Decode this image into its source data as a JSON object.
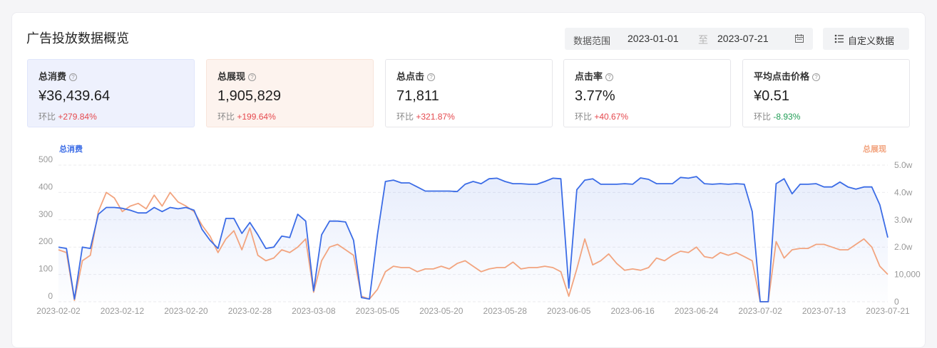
{
  "header": {
    "title": "广告投放数据概览",
    "range_label": "数据范围",
    "start_date": "2023-01-01",
    "range_sep": "至",
    "end_date": "2023-07-21",
    "custom_label": "自定义数据"
  },
  "metrics": [
    {
      "label": "总消费",
      "value": "¥36,439.64",
      "change_label": "环比",
      "change": "+279.84%",
      "trend": "up"
    },
    {
      "label": "总展现",
      "value": "1,905,829",
      "change_label": "环比",
      "change": "+199.64%",
      "trend": "up"
    },
    {
      "label": "总点击",
      "value": "71,811",
      "change_label": "环比",
      "change": "+321.87%",
      "trend": "up"
    },
    {
      "label": "点击率",
      "value": "3.77%",
      "change_label": "环比",
      "change": "+40.67%",
      "trend": "up"
    },
    {
      "label": "平均点击价格",
      "value": "¥0.51",
      "change_label": "环比",
      "change": "-8.93%",
      "trend": "down"
    }
  ],
  "colors": {
    "spend": "#3b6ce6",
    "impressions": "#f2a47f",
    "up": "#e5484d",
    "down": "#1f9d55"
  },
  "chart_data": {
    "type": "line",
    "left_axis_label": "总消费",
    "right_axis_label": "总展现",
    "y_left_ticks": [
      "500",
      "400",
      "300",
      "200",
      "100",
      "0"
    ],
    "y_right_ticks": [
      "5.0w",
      "4.0w",
      "3.0w",
      "2.0w",
      "10,000",
      "0"
    ],
    "ylim_left": [
      0,
      500
    ],
    "ylim_right": [
      0,
      50000
    ],
    "x_ticks": [
      "2023-02-02",
      "2023-02-12",
      "2023-02-20",
      "2023-02-28",
      "2023-03-08",
      "2023-05-05",
      "2023-05-20",
      "2023-05-28",
      "2023-06-05",
      "2023-06-16",
      "2023-06-24",
      "2023-07-02",
      "2023-07-13",
      "2023-07-21"
    ],
    "grid": "horizontal dashed",
    "series": [
      {
        "name": "总消费",
        "axis": "left",
        "area": true,
        "values": [
          200,
          195,
          10,
          200,
          195,
          320,
          345,
          345,
          342,
          335,
          325,
          325,
          345,
          330,
          345,
          340,
          345,
          335,
          265,
          225,
          195,
          305,
          305,
          250,
          290,
          245,
          195,
          200,
          240,
          235,
          320,
          295,
          40,
          245,
          295,
          295,
          292,
          225,
          15,
          10,
          245,
          440,
          445,
          435,
          435,
          420,
          405,
          405,
          405,
          405,
          403,
          430,
          440,
          432,
          450,
          452,
          440,
          432,
          432,
          430,
          430,
          440,
          452,
          450,
          50,
          410,
          445,
          450,
          430,
          430,
          430,
          432,
          430,
          453,
          448,
          432,
          432,
          432,
          455,
          452,
          458,
          432,
          430,
          432,
          430,
          432,
          430,
          330,
          0,
          0,
          432,
          450,
          395,
          430,
          430,
          432,
          420,
          420,
          438,
          420,
          412,
          420,
          420,
          355,
          235
        ]
      },
      {
        "name": "总展现",
        "axis": "right",
        "values": [
          19000,
          18000,
          500,
          15000,
          17000,
          33000,
          40000,
          38000,
          33000,
          35000,
          36000,
          34000,
          39000,
          35000,
          40000,
          36500,
          35000,
          33000,
          28000,
          24000,
          18000,
          23000,
          26000,
          19000,
          27000,
          17000,
          15000,
          16000,
          19000,
          18000,
          20000,
          23000,
          3500,
          15000,
          20000,
          21000,
          19000,
          17000,
          2000,
          1000,
          4500,
          11000,
          13000,
          12500,
          12500,
          11000,
          12000,
          12000,
          13000,
          12000,
          14000,
          15000,
          13000,
          11000,
          12000,
          12500,
          12500,
          14500,
          12000,
          12500,
          12500,
          13000,
          12500,
          11000,
          2000,
          12000,
          23000,
          13500,
          15000,
          17500,
          14000,
          11500,
          12000,
          11500,
          12500,
          16000,
          15000,
          17000,
          18500,
          18000,
          20000,
          16500,
          16000,
          18000,
          17000,
          18000,
          16500,
          15000,
          0,
          0,
          22000,
          16000,
          19000,
          19500,
          19500,
          21000,
          21000,
          20000,
          19000,
          19000,
          21000,
          23000,
          20000,
          13000,
          10000
        ]
      }
    ]
  }
}
